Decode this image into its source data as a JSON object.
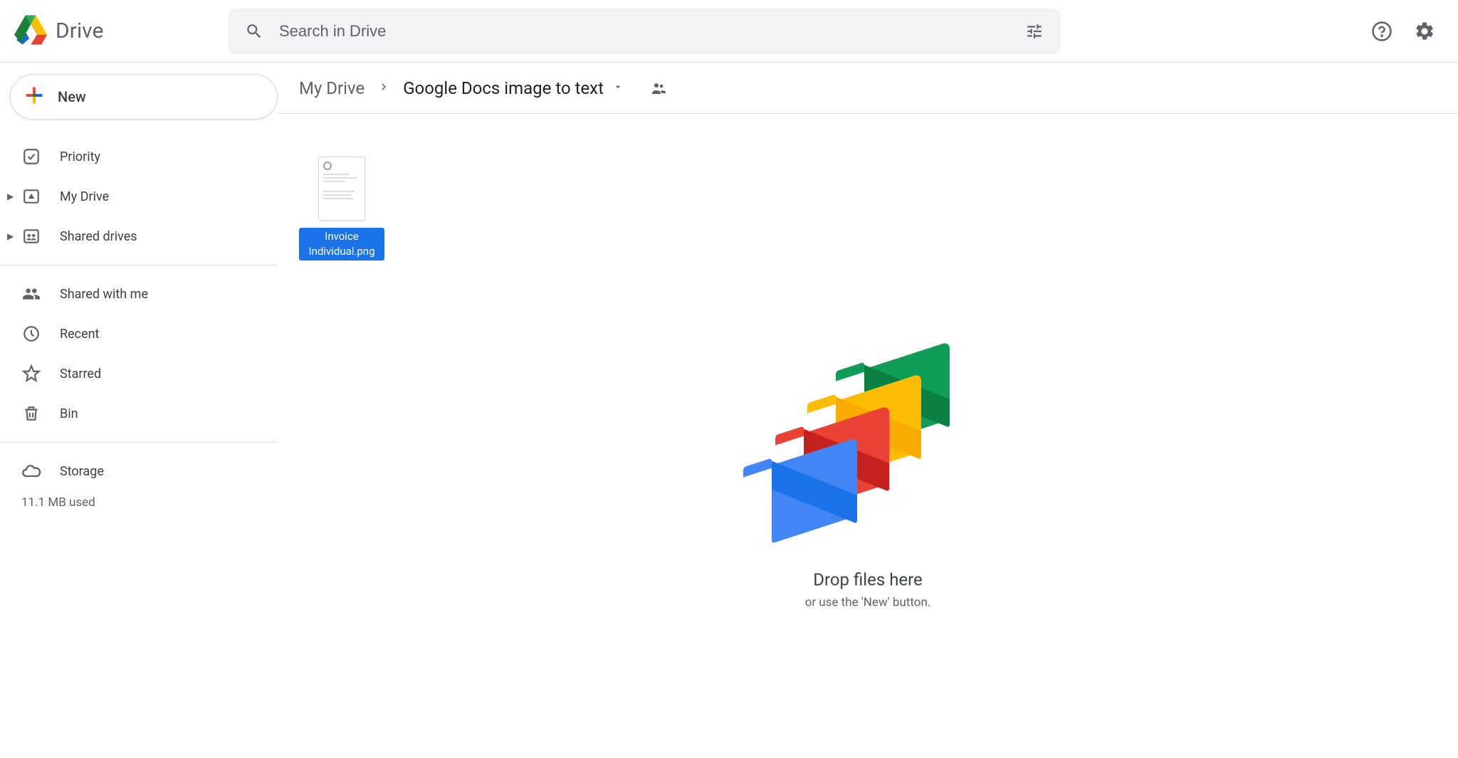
{
  "app": {
    "name": "Drive"
  },
  "search": {
    "placeholder": "Search in Drive"
  },
  "newButton": {
    "label": "New"
  },
  "sidebar": {
    "section1": [
      {
        "label": "Priority"
      },
      {
        "label": "My Drive"
      },
      {
        "label": "Shared drives"
      }
    ],
    "section2": [
      {
        "label": "Shared with me"
      },
      {
        "label": "Recent"
      },
      {
        "label": "Starred"
      },
      {
        "label": "Bin"
      }
    ],
    "storage": {
      "label": "Storage",
      "used": "11.1 MB used"
    }
  },
  "breadcrumb": {
    "root": "My Drive",
    "current": "Google Docs image to text"
  },
  "files": [
    {
      "name": "Invoice Individual.png",
      "selected": true
    }
  ],
  "dropzone": {
    "title": "Drop files here",
    "subtitle": "or use the 'New' button."
  }
}
